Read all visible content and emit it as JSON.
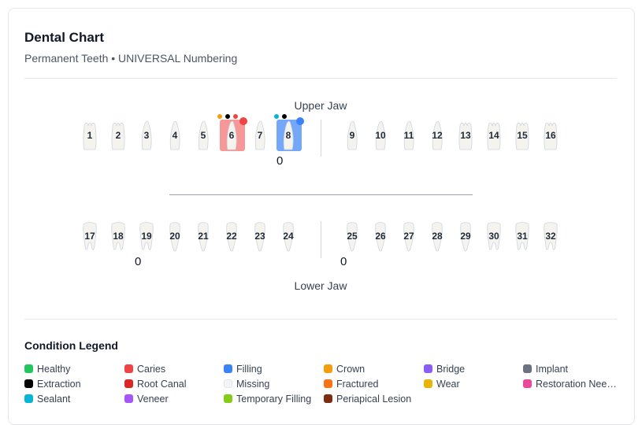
{
  "header": {
    "title": "Dental Chart",
    "subtitle": "Permanent Teeth • UNIVERSAL Numbering"
  },
  "upper_jaw": {
    "label": "Upper Jaw",
    "counter_left": "0",
    "teeth": [
      "1",
      "2",
      "3",
      "4",
      "5",
      "6",
      "7",
      "8",
      "9",
      "10",
      "11",
      "12",
      "13",
      "14",
      "15",
      "16"
    ]
  },
  "lower_jaw": {
    "label": "Lower Jaw",
    "counter_left": "0",
    "counter_right": "0",
    "teeth": [
      "17",
      "18",
      "19",
      "20",
      "21",
      "22",
      "23",
      "24",
      "25",
      "26",
      "27",
      "28",
      "29",
      "30",
      "31",
      "32"
    ]
  },
  "tooth_conditions": {
    "6": [
      "crown",
      "extraction",
      "caries"
    ],
    "8": [
      "sealant",
      "extraction",
      "filling"
    ]
  },
  "legend": {
    "title": "Condition Legend",
    "items": [
      {
        "label": "Healthy",
        "color": "#22c55e"
      },
      {
        "label": "Caries",
        "color": "#ef4444"
      },
      {
        "label": "Filling",
        "color": "#3b82f6"
      },
      {
        "label": "Crown",
        "color": "#f59e0b"
      },
      {
        "label": "Bridge",
        "color": "#8b5cf6"
      },
      {
        "label": "Implant",
        "color": "#6b7280"
      },
      {
        "label": "Extraction",
        "color": "#000000"
      },
      {
        "label": "Root Canal",
        "color": "#dc2626"
      },
      {
        "label": "Missing",
        "color": "#f3f4f6"
      },
      {
        "label": "Fractured",
        "color": "#f97316"
      },
      {
        "label": "Wear",
        "color": "#eab308"
      },
      {
        "label": "Restoration Nee…",
        "color": "#ec4899"
      },
      {
        "label": "Sealant",
        "color": "#06b6d4"
      },
      {
        "label": "Veneer",
        "color": "#a855f7"
      },
      {
        "label": "Temporary Filling",
        "color": "#84cc16"
      },
      {
        "label": "Periapical Lesion",
        "color": "#7c2d12"
      }
    ]
  }
}
